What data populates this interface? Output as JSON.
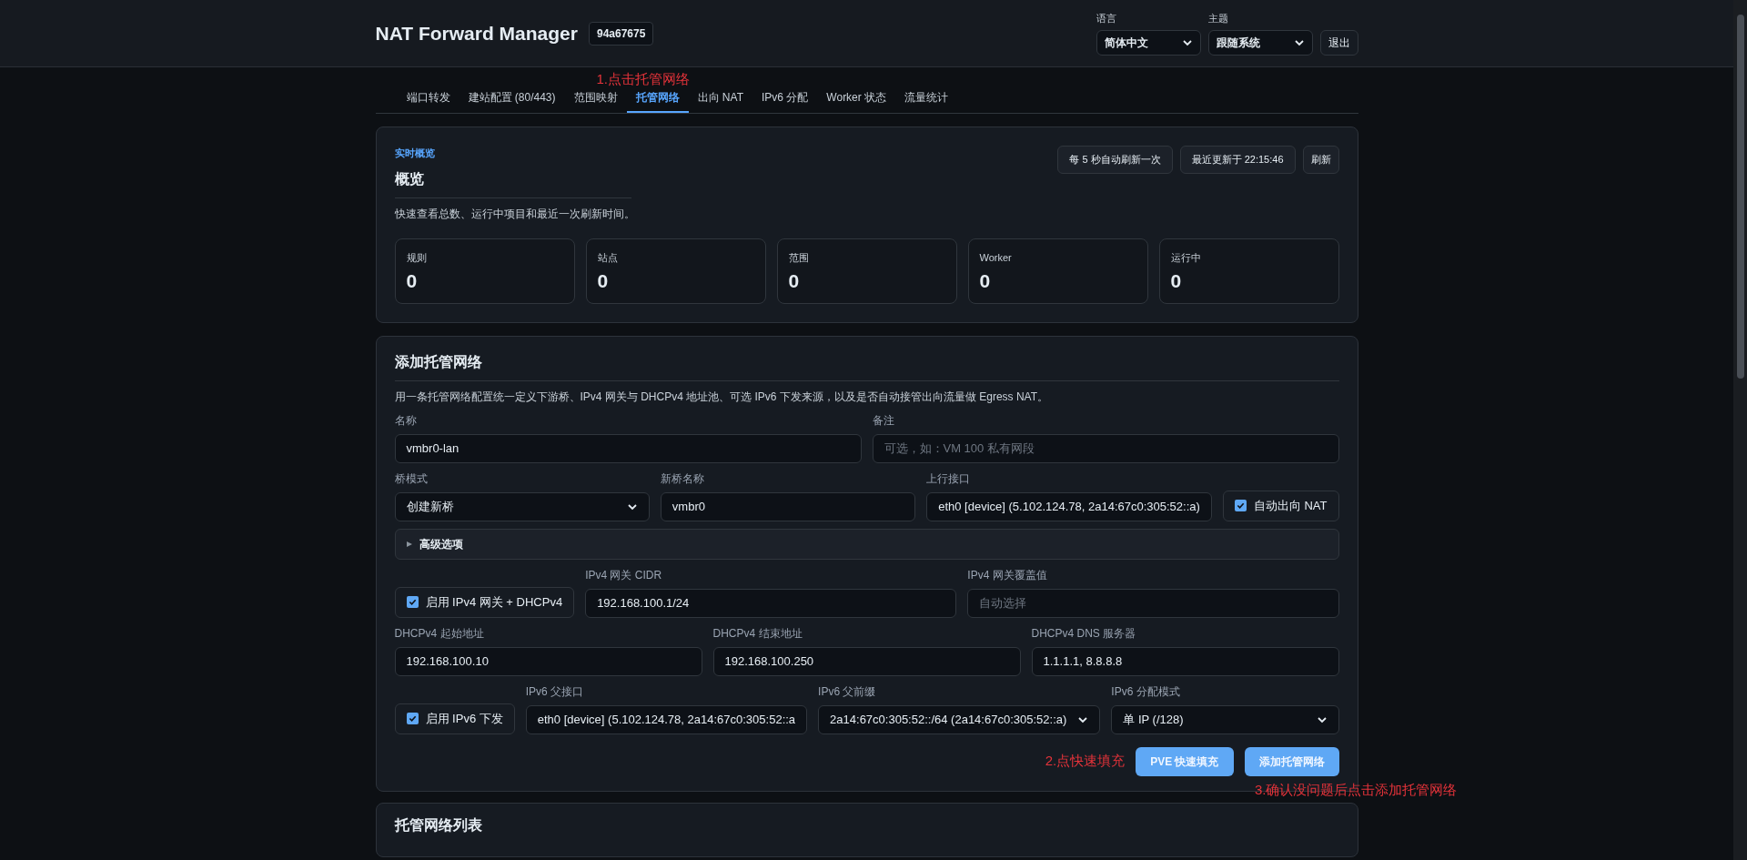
{
  "header": {
    "title": "NAT Forward Manager",
    "version": "94a67675",
    "language": {
      "label": "语言",
      "value": "简体中文"
    },
    "theme": {
      "label": "主题",
      "value": "跟随系统"
    },
    "logout": "退出"
  },
  "tabs_hint": "1.点击托管网络",
  "tabs": [
    {
      "label": "端口转发",
      "selected": false
    },
    {
      "label": "建站配置 (80/443)",
      "selected": false
    },
    {
      "label": "范围映射",
      "selected": false
    },
    {
      "label": "托管网络",
      "selected": true
    },
    {
      "label": "出向 NAT",
      "selected": false
    },
    {
      "label": "IPv6 分配",
      "selected": false
    },
    {
      "label": "Worker 状态",
      "selected": false
    },
    {
      "label": "流量统计",
      "selected": false
    }
  ],
  "overview": {
    "eyebrow": "实时概览",
    "title": "概览",
    "description": "快速查看总数、运行中项目和最近一次刷新时间。",
    "badges": [
      "每 5 秒自动刷新一次",
      "最近更新于 22:15:46"
    ],
    "refresh": "刷新",
    "stats": [
      {
        "label": "规则",
        "value": "0"
      },
      {
        "label": "站点",
        "value": "0"
      },
      {
        "label": "范围",
        "value": "0"
      },
      {
        "label": "Worker",
        "value": "0"
      },
      {
        "label": "运行中",
        "value": "0"
      }
    ]
  },
  "form": {
    "title": "添加托管网络",
    "description": "用一条托管网络配置统一定义下游桥、IPv4 网关与 DHCPv4 地址池、可选 IPv6 下发来源，以及是否自动接管出向流量做 Egress NAT。",
    "rows_top": [
      [
        {
          "kind": "input",
          "label": "名称",
          "value": "vmbr0-lan"
        },
        {
          "kind": "input",
          "label": "备注",
          "placeholder": "可选，如：VM 100 私有网段"
        }
      ],
      [
        {
          "kind": "select",
          "label": "桥模式",
          "value": "创建新桥"
        },
        {
          "kind": "input",
          "label": "新桥名称",
          "value": "vmbr0"
        },
        {
          "kind": "input",
          "label": "上行接口",
          "value": "eth0 [device] (5.102.124.78, 2a14:67c0:305:52::a)"
        },
        {
          "kind": "checkbox",
          "label": "自动出向 NAT",
          "checked": true
        }
      ]
    ],
    "advanced": {
      "label": "高级选项",
      "expanded": false
    },
    "rows_bottom": [
      [
        {
          "kind": "checkbox",
          "label": "启用 IPv4 网关 + DHCPv4",
          "checked": true
        },
        {
          "kind": "input",
          "label": "IPv4 网关 CIDR",
          "value": "192.168.100.1/24"
        },
        {
          "kind": "input",
          "label": "IPv4 网关覆盖值",
          "placeholder": "自动选择"
        }
      ],
      [
        {
          "kind": "input",
          "label": "DHCPv4 起始地址",
          "value": "192.168.100.10"
        },
        {
          "kind": "input",
          "label": "DHCPv4 结束地址",
          "value": "192.168.100.250"
        },
        {
          "kind": "input",
          "label": "DHCPv4 DNS 服务器",
          "value": "1.1.1.1, 8.8.8.8"
        }
      ],
      [
        {
          "kind": "checkbox",
          "label": "启用 IPv6 下发",
          "checked": true
        },
        {
          "kind": "input",
          "label": "IPv6 父接口",
          "value": "eth0 [device] (5.102.124.78, 2a14:67c0:305:52::a"
        },
        {
          "kind": "select",
          "label": "IPv6 父前缀",
          "value": "2a14:67c0:305:52::/64 (2a14:67c0:305:52::a)"
        },
        {
          "kind": "select",
          "label": "IPv6 分配模式",
          "value": "单 IP (/128)"
        }
      ]
    ],
    "fill_hint": "2.点快速填充",
    "buttons": [
      "PVE 快速填充",
      "添加托管网络"
    ],
    "submit_hint": "3.确认没问题后点击添加托管网络"
  },
  "list": {
    "title": "托管网络列表"
  }
}
